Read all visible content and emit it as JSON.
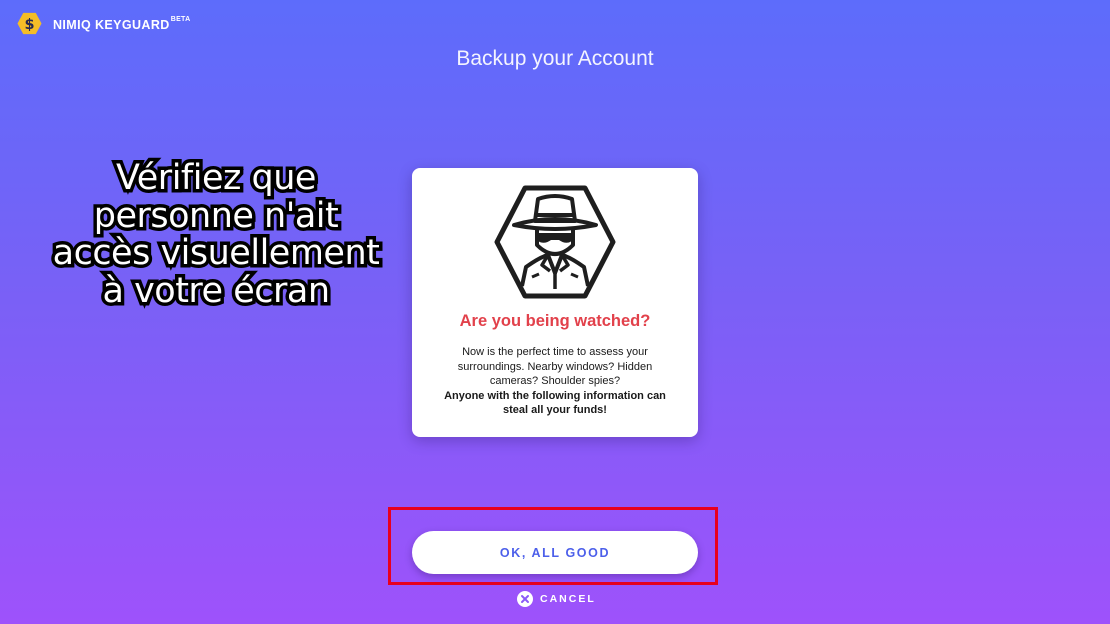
{
  "header": {
    "brand_name": "NIMIQ KEYGUARD",
    "brand_badge": "BETA",
    "logo_icon": "nimiq-hexagon-logo-icon"
  },
  "page": {
    "title": "Backup your Account"
  },
  "overlay_caption": {
    "line1": "Vérifiez que",
    "line2": "personne n'ait",
    "line3": "accès visuellement",
    "line4": "à votre écran"
  },
  "card": {
    "icon": "spy-icon",
    "heading": "Are you being watched?",
    "line1": "Now is the perfect time to assess your",
    "line2": "surroundings. Nearby windows? Hidden",
    "line3": "cameras? Shoulder spies?",
    "warning_line1": "Anyone with the following information can",
    "warning_line2": "steal all your funds!"
  },
  "actions": {
    "confirm_label": "OK, ALL GOOD",
    "cancel_label": "CANCEL",
    "cancel_icon": "close-circle-icon"
  },
  "colors": {
    "background_top": "#5d6cfb",
    "background_bottom": "#9e52fb",
    "heading_red": "#e2414b",
    "button_text": "#4c5fea",
    "logo_gold": "#f5bd27",
    "highlight_red": "#e8001e"
  }
}
